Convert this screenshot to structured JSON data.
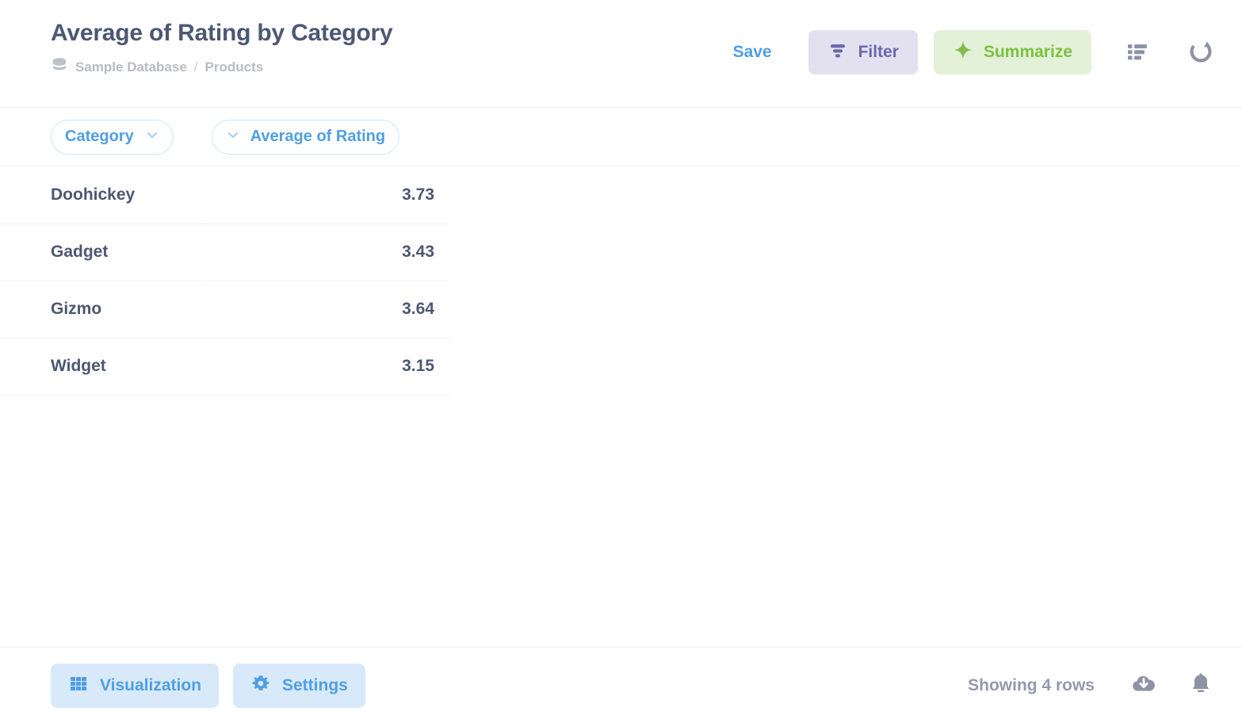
{
  "header": {
    "title": "Average of Rating by Category",
    "breadcrumb": {
      "db_icon": "database-icon",
      "database": "Sample Database",
      "separator": "/",
      "table": "Products"
    },
    "actions": {
      "save_label": "Save",
      "filter_label": "Filter",
      "filter_icon": "filter-icon",
      "summarize_label": "Summarize",
      "summarize_icon": "sparkle-icon",
      "table_view_icon": "table-list-icon",
      "refresh_icon": "refresh-icon"
    }
  },
  "columns": [
    {
      "label": "Category",
      "chevron": "chevron-down-icon",
      "chevron_side": "right"
    },
    {
      "label": "Average of Rating",
      "chevron": "chevron-down-icon",
      "chevron_side": "left"
    }
  ],
  "table": {
    "rows": [
      {
        "category": "Doohickey",
        "average_of_rating": "3.73"
      },
      {
        "category": "Gadget",
        "average_of_rating": "3.43"
      },
      {
        "category": "Gizmo",
        "average_of_rating": "3.64"
      },
      {
        "category": "Widget",
        "average_of_rating": "3.15"
      }
    ]
  },
  "footer": {
    "visualization_label": "Visualization",
    "visualization_icon": "grid-icon",
    "settings_label": "Settings",
    "settings_icon": "gear-icon",
    "row_count": "Showing 4 rows",
    "download_icon": "download-cloud-icon",
    "alert_icon": "bell-icon"
  },
  "colors": {
    "brand_blue": "#509ee3",
    "text_dark": "#4c5773",
    "text_muted": "#949aab",
    "filter_bg": "#e3e1f0",
    "filter_fg": "#6a68ad",
    "summarize_bg": "#e4f1d9",
    "summarize_fg": "#7bc13f",
    "footer_btn_bg": "#d8e9f9",
    "border": "#edeff0"
  }
}
